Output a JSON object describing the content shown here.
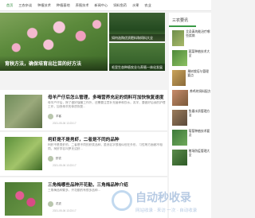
{
  "nav": {
    "items": [
      "首页",
      "三农杂谈",
      "种植技术",
      "种植基地",
      "养殖技术",
      "新闻中心",
      "饲料鱼药",
      "水果",
      "农业"
    ],
    "active_index": 0
  },
  "hero": {
    "caption": "育秧方法，确保培育出壮苗的好方法"
  },
  "side_thumbs": [
    {
      "caption": "如何选购优质肥料和饲料大全"
    },
    {
      "caption": "毛里生态种植农业与养殖一体化发展"
    }
  ],
  "sidebar": {
    "heading": "三农要讯",
    "items": [
      {
        "title": "艾灸真的能治疗哪些疾病",
        "sub": ""
      },
      {
        "title": "蔬菜种植技术大全",
        "sub": ""
      },
      {
        "title": "果树栽培与管理要点",
        "sub": ""
      },
      {
        "title": "养鸡的饲料配方",
        "sub": ""
      },
      {
        "title": "鱼塘水质管理方法",
        "sub": ""
      },
      {
        "title": "葡萄种植技术要点",
        "sub": ""
      },
      {
        "title": "猪场防疫管理大全",
        "sub": ""
      }
    ]
  },
  "articles": [
    {
      "title": "母羊产仔后怎么管理，多喝营养充足的饲料可加快恢复速度",
      "desc": "母羊产仔后，除了做好保暖工作外，还需要注意补充营养和饮水。羔羊，要做好后续的护理工作，加快母羊的体质恢复...",
      "author": "羊客",
      "date": "2021-05-06 13:23:17"
    },
    {
      "title": "柯虾是不是男虾，二者是不同的品种",
      "desc": "柯虾不是男虾的，二者是不同的虾类品种，虽然名字很相似但在外形、习性等方面都不相同，柯虾学名叫罗氏沼虾...",
      "author": "虾农",
      "date": "2021-05-06 13:23:17"
    },
    {
      "title": "三角梅哪些品种开花勤，三角梅品种介绍",
      "desc": "三角梅品种繁多，开花勤的有很多品种...",
      "author": "花农",
      "date": "2021-05-06 13:23:17"
    }
  ],
  "watermark": {
    "main": "自动秒收录",
    "sub": "网站收录 · 来访 一次 · 自动收录"
  },
  "colors": {
    "accent": "#2e8b3a",
    "sidebar_underline": "#3a9a46"
  }
}
